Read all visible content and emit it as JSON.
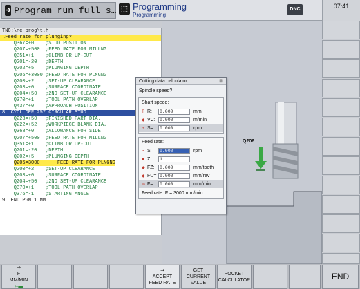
{
  "topbar": {
    "left_mode": "Program run full s…",
    "right_mode": "Programming",
    "right_sub": "Programming",
    "dnc": "DNC",
    "time": "07:41"
  },
  "program": {
    "path": "TNC:\\nc_prog\\t.h",
    "header": "→Feed rate for plunging?",
    "lines": [
      "    Q367=+0    ;STUD POSITION",
      "    Q207=+500  ;FEED RATE FOR MILLNG",
      "    Q351=+1    ;CLIMB OR UP-CUT",
      "    Q201=-20   ;DEPTH",
      "    Q202=+5    ;PLUNGING DEPTH",
      "    Q206=+3000 ;FEED RATE FOR PLNGNG",
      "    Q200=+2    ;SET-UP CLEARANCE",
      "    Q203=+0    ;SURFACE COORDINATE",
      "    Q204=+50   ;2ND SET-UP CLEARANCE",
      "    Q370=+1    ;TOOL PATH OVERLAP",
      "    Q437=+0    ;APPROACH POSITION"
    ],
    "cycle": "8  CYCL DEF 257 CIRCULAR STUD",
    "lines2": [
      "    Q223=+50   ;FINISHED PART DIA.",
      "    Q222=+52   ;WORKPIECE BLANK DIA.",
      "    Q368=+0    ;ALLOWANCE FOR SIDE",
      "    Q207=+500  ;FEED RATE FOR MILLNG",
      "    Q351=+1    ;CLIMB OR UP-CUT",
      "    Q201=-20   ;DEPTH",
      "    Q202=+5    ;PLUNGING DEPTH"
    ],
    "current_prefix": "    ",
    "current_hl": "Q206=3000",
    "current_rest": "      FEED RATE FOR PLNGNG",
    "lines3": [
      "    Q200=+2    ;SET-UP CLEARANCE",
      "    Q203=+0    ;SURFACE COORDINATE",
      "    Q204=+50   ;2ND SET-UP CLEARANCE",
      "    Q370=+1    ;TOOL PATH OVERLAP",
      "    Q376=-1    ;STARTING ANGLE"
    ],
    "end": "9  END PGM 1 MM"
  },
  "graphic": {
    "label": "Q206"
  },
  "dialog": {
    "title": "Cutting data calculator",
    "close": "⊠",
    "question": "Spindle speed?",
    "shaft_title": "Shaft speed:",
    "shaft_fields": [
      {
        "icon": "T",
        "label": "R:",
        "value": "0.000",
        "unit": "mm"
      },
      {
        "icon": "◆",
        "label": "VC:",
        "value": "0.000",
        "unit": "m/min"
      },
      {
        "icon": "◔",
        "label": "S=",
        "value": "0.000",
        "unit": "rpm"
      }
    ],
    "feed_title": "Feed rate:",
    "feed_fields": [
      {
        "icon": "◔",
        "label": "S:",
        "value": "0.000",
        "unit": "rpm"
      },
      {
        "icon": "■",
        "label": "Z:",
        "value": "1",
        "unit": ""
      },
      {
        "icon": "◆",
        "label": "FZ:",
        "value": "0.000",
        "unit": "mm/tooth"
      },
      {
        "icon": "◆",
        "label": "FU=",
        "value": "0.000",
        "unit": "mm/rev"
      },
      {
        "icon": "⇒",
        "label": "F=",
        "value": "0.000",
        "unit": "mm/min"
      }
    ],
    "result": "Feed rate: F = 3000 mm/min"
  },
  "softkeys": {
    "f_label": "F",
    "f_sub": "MM/MIN",
    "accept_1": "ACCEPT",
    "accept_2": "FEED RATE",
    "get_1": "GET",
    "get_2": "CURRENT",
    "get_3": "VALUE",
    "pocket_1": "POCKET",
    "pocket_2": "CALCULATOR",
    "end": "END"
  }
}
